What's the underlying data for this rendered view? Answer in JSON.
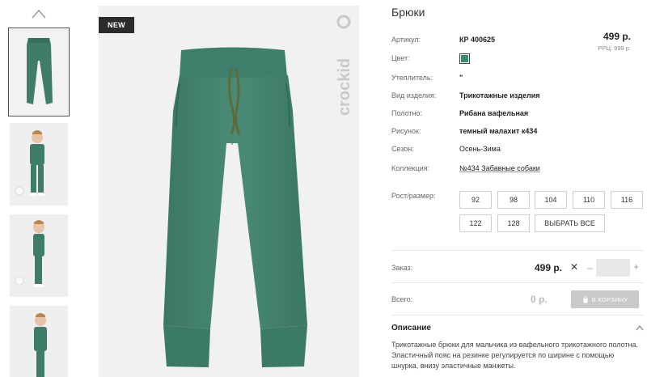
{
  "badge": {
    "new": "NEW"
  },
  "brand": {
    "logo_text": "crockid"
  },
  "product": {
    "title": "Брюки",
    "price": "499 р.",
    "rrp": "РРЦ: 999 р.",
    "color_hex": "#3b8a6a",
    "details": [
      {
        "label": "Артикул:",
        "value": "КР 400625",
        "bold": true
      },
      {
        "label": "Цвет:",
        "value": "",
        "bold": false
      },
      {
        "label": "Утеплитель:",
        "value": "\"",
        "bold": true
      },
      {
        "label": "Вид изделия:",
        "value": "Трикотажные изделия",
        "bold": true
      },
      {
        "label": "Полотно:",
        "value": "Рибана вафельная",
        "bold": true
      },
      {
        "label": "Рисунок:",
        "value": "темный малахит к434",
        "bold": true
      },
      {
        "label": "Сезон:",
        "value": "Осень-Зима",
        "bold": false
      },
      {
        "label": "Коллекция:",
        "value": "№434 Забавные собаки",
        "bold": false
      }
    ]
  },
  "sizes": {
    "label": "Рост/размер:",
    "options": [
      "92",
      "98",
      "104",
      "110",
      "116",
      "122",
      "128"
    ],
    "select_all": "ВЫБРАТЬ ВСЕ"
  },
  "order": {
    "label": "Заказ:",
    "price": "499 р.",
    "multiply": "✕",
    "minus": "–",
    "plus": "+",
    "quantity": ""
  },
  "total": {
    "label": "Всего:",
    "value": "0 р.",
    "cart_button": "В КОРЗИНУ"
  },
  "description": {
    "title": "Описание",
    "text": "Трикотажные брюки для мальчика из вафельного трикотажного полотна. Эластичный пояс на резинке регулируется по ширине с помощью шнурка, внизу эластичные манжеты."
  }
}
